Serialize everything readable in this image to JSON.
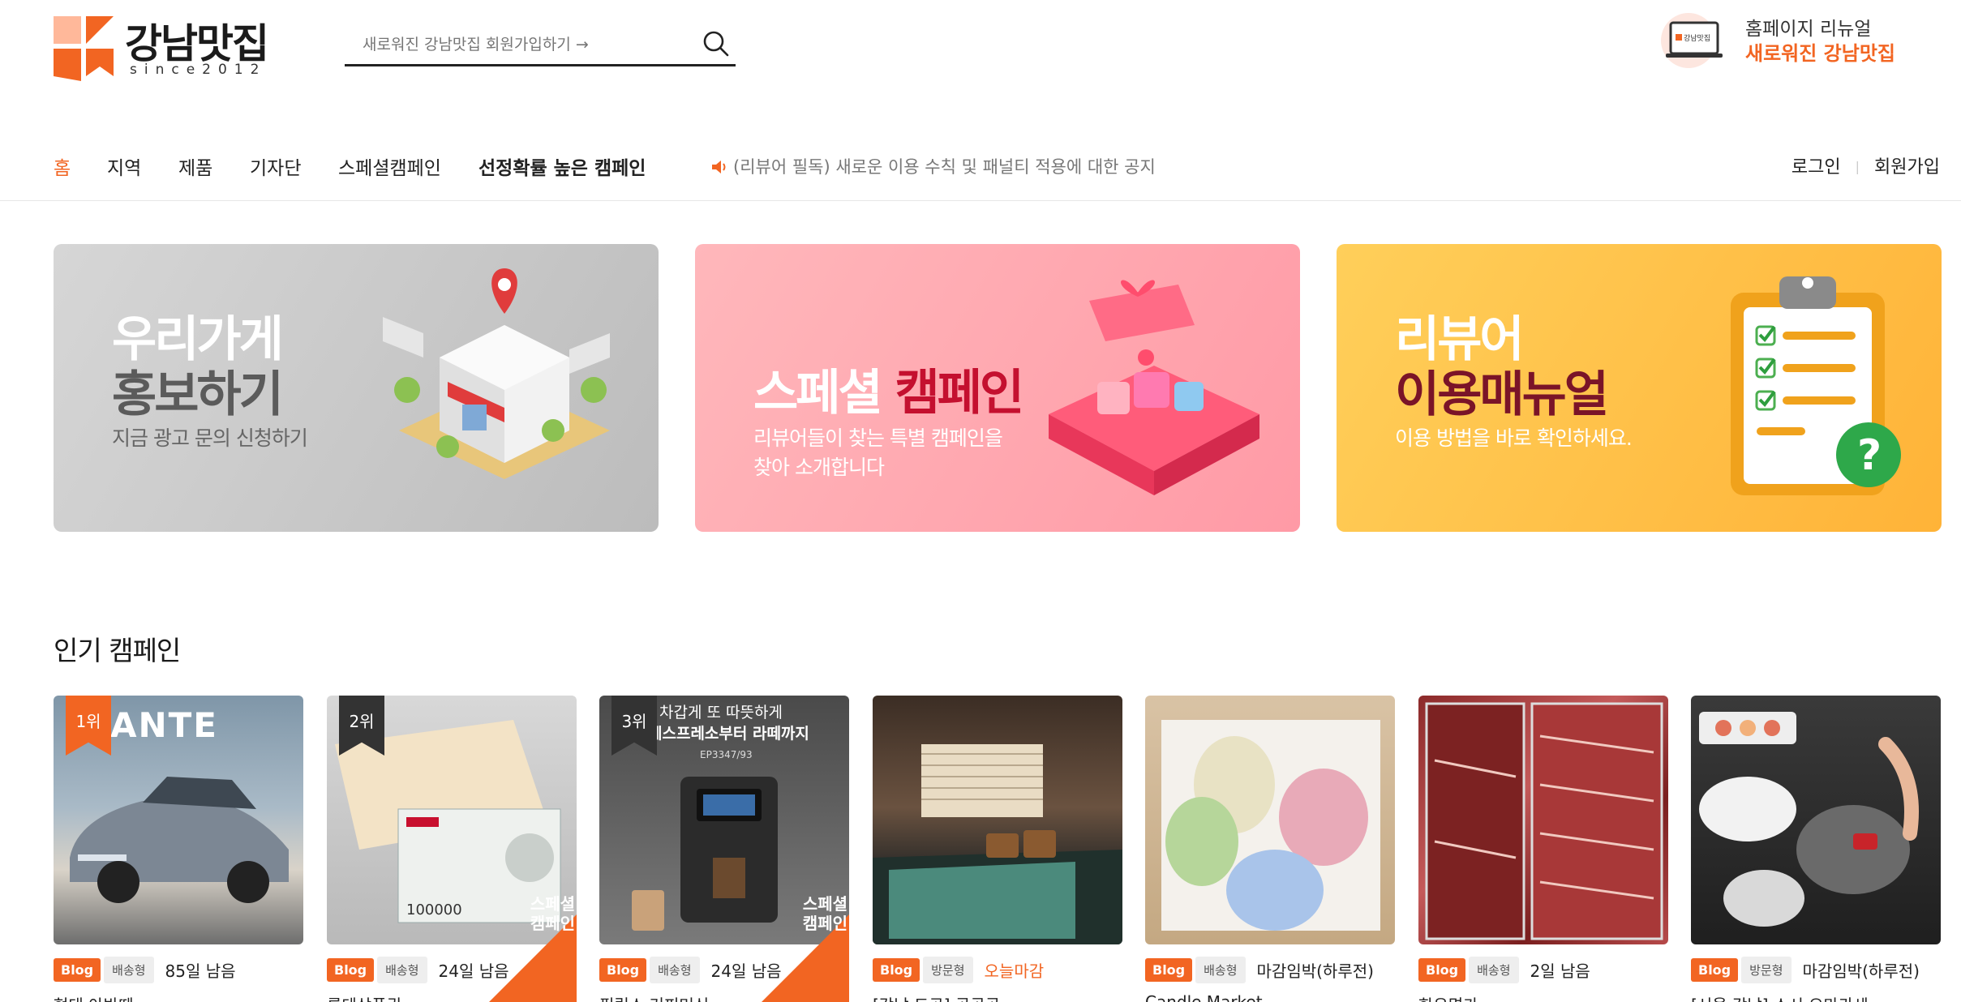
{
  "brand": {
    "name": "강남맛집",
    "since": "since2012"
  },
  "search": {
    "placeholder": "새로워진 강남맛집 회원가입하기 →",
    "value": ""
  },
  "renewal": {
    "line1": "홈페이지 리뉴얼",
    "line2": "새로워진 강남맛집",
    "screen_text": "강남맛집"
  },
  "nav": {
    "items": [
      {
        "label": "홈",
        "active": true
      },
      {
        "label": "지역"
      },
      {
        "label": "제품"
      },
      {
        "label": "기자단"
      },
      {
        "label": "스페셜캠페인"
      },
      {
        "label": "선정확률 높은 캠페인",
        "strong": true
      }
    ],
    "notice": "(리뷰어 필독) 새로운 이용 수칙 및 패널티 적용에 대한 공지",
    "login": "로그인",
    "signup": "회원가입"
  },
  "banners": [
    {
      "title1": "우리가게",
      "title2": "홍보하기",
      "subtitle": "지금 광고 문의 신청하기"
    },
    {
      "title_plain": "스페셜 ",
      "title_accent": "캠페인",
      "subtitle1": "리뷰어들이 찾는 특별 캠페인을",
      "subtitle2": "찾아 소개합니다"
    },
    {
      "title1": "리뷰어",
      "title2": "이용매뉴얼",
      "subtitle": "이용 방법을 바로 확인하세요."
    }
  ],
  "popular": {
    "title": "인기 캠페인",
    "cards": [
      {
        "rank": "1위",
        "blog": "Blog",
        "type": "배송형",
        "deadline": "85일 남음",
        "title": "현대 아반떼",
        "image_text": "ANTE",
        "special": false
      },
      {
        "rank": "2위",
        "blog": "Blog",
        "type": "배송형",
        "deadline": "24일 남음",
        "title": "롯데상품권",
        "image_text": "100000",
        "special": true,
        "special_line1": "스페셜",
        "special_line2": "캠페인"
      },
      {
        "rank": "3위",
        "blog": "Blog",
        "type": "배송형",
        "deadline": "24일 남음",
        "title": "필립스 커피머신",
        "image_text1": "차갑게 또 따뜻하게",
        "image_text2": "에스프레소부터 라떼까지",
        "image_text3": "EP3347/93",
        "special": true,
        "special_line1": "스페셜",
        "special_line2": "캠페인"
      },
      {
        "rank": "",
        "blog": "Blog",
        "type": "방문형",
        "deadline": "오늘마감",
        "urgent": true,
        "title": "[강남 도곡] 공공공",
        "special": false
      },
      {
        "rank": "",
        "blog": "Blog",
        "type": "배송형",
        "deadline": "마감임박(하루전)",
        "title": "Candle Market",
        "special": false
      },
      {
        "rank": "",
        "blog": "Blog",
        "type": "배송형",
        "deadline": "2일 남음",
        "title": "한우명가",
        "special": false
      },
      {
        "rank": "",
        "blog": "Blog",
        "type": "방문형",
        "deadline": "마감임박(하루전)",
        "title": "[서울 강남] 스시 오마카세",
        "special": false
      }
    ]
  },
  "colors": {
    "accent": "#f26522",
    "text": "#222222",
    "muted": "#777777"
  }
}
